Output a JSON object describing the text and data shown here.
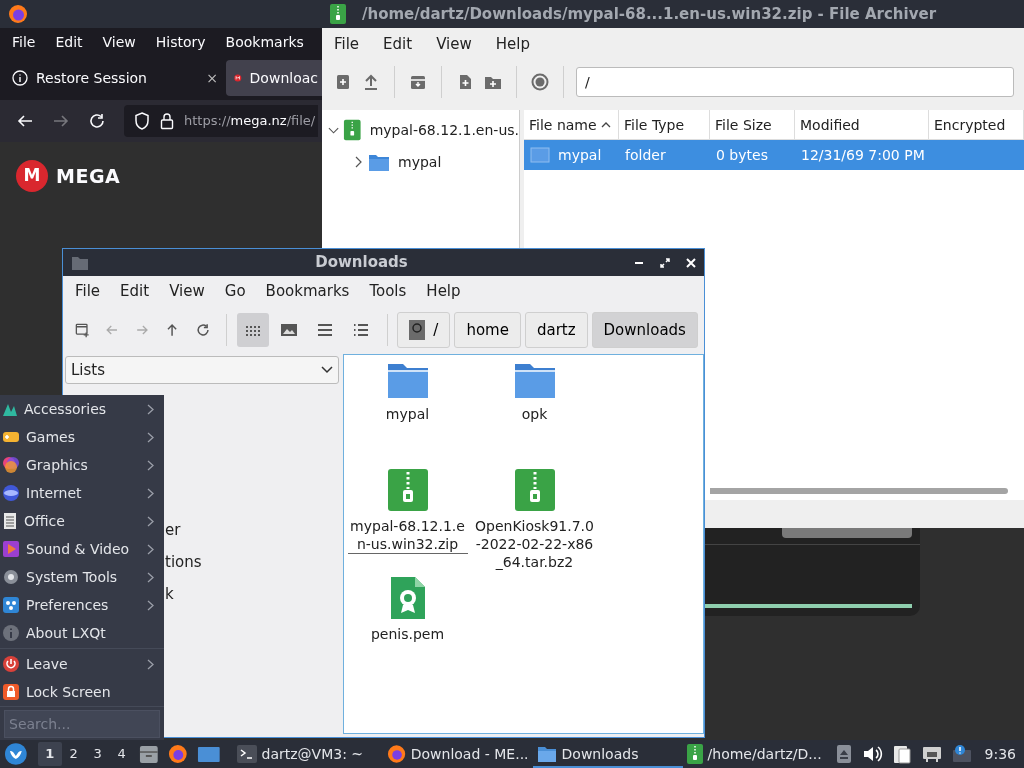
{
  "browser": {
    "menu": [
      "File",
      "Edit",
      "View",
      "History",
      "Bookmarks"
    ],
    "tabs": [
      {
        "label": "Restore Session",
        "selected": false,
        "close": "×"
      },
      {
        "label": "Downloac",
        "selected": true
      }
    ],
    "url_parts": [
      "https://",
      "mega.nz",
      "/file/"
    ],
    "logo_letter": "M",
    "brand": "MEGA"
  },
  "archiver": {
    "title": "/home/dartz/Downloads/mypal-68...1.en-us.win32.zip - File Archiver",
    "menu": [
      "File",
      "Edit",
      "View",
      "Help"
    ],
    "path": "/",
    "tree": [
      {
        "label": "mypal-68.12.1.en-us.",
        "expanded": true,
        "children": [
          {
            "label": "mypal",
            "expanded": false
          }
        ]
      }
    ],
    "columns": [
      {
        "label": "File name",
        "sorted": true
      },
      {
        "label": "File Type",
        "sorted": false
      },
      {
        "label": "File Size",
        "sorted": false
      },
      {
        "label": "Modified",
        "sorted": false
      },
      {
        "label": "Encrypted",
        "sorted": false
      }
    ],
    "rows": [
      {
        "cells": [
          "mypal",
          "folder",
          "0 bytes",
          "12/31/69 7:00 PM"
        ],
        "selected": true
      }
    ]
  },
  "downloads": {
    "title": "Downloads",
    "menu": [
      "File",
      "Edit",
      "View",
      "Go",
      "Bookmarks",
      "Tools",
      "Help"
    ],
    "view_modes": [
      {
        "kind": "icons",
        "selected": true
      },
      {
        "kind": "thumbnails",
        "selected": false
      },
      {
        "kind": "compact",
        "selected": false
      },
      {
        "kind": "details",
        "selected": false
      }
    ],
    "breadcrumbs": [
      {
        "label": "/",
        "kind": "root",
        "selected": false
      },
      {
        "label": "home",
        "kind": "dir",
        "selected": false
      },
      {
        "label": "dartz",
        "kind": "dir",
        "selected": false
      },
      {
        "label": "Downloads",
        "kind": "dir",
        "selected": true
      }
    ],
    "side_dropdown": "Lists",
    "side_items": [
      "er",
      "tions",
      "k"
    ],
    "files": [
      {
        "name": "mypal",
        "kind": "folder",
        "current": false
      },
      {
        "name": "opk",
        "kind": "folder",
        "current": false
      },
      {
        "name": "mypal-68.12.1.en-us.win32.zip",
        "kind": "archive",
        "current": true
      },
      {
        "name": "OpenKiosk91.7.0-2022-02-22-x86_64.tar.bz2",
        "kind": "archive",
        "current": false
      },
      {
        "name": "penis.pem",
        "kind": "certificate",
        "current": false
      }
    ]
  },
  "start_menu": {
    "items": [
      {
        "label": "Accessories",
        "kind": "submenu"
      },
      {
        "label": "Games",
        "kind": "submenu"
      },
      {
        "label": "Graphics",
        "kind": "submenu"
      },
      {
        "label": "Internet",
        "kind": "submenu"
      },
      {
        "label": "Office",
        "kind": "submenu"
      },
      {
        "label": "Sound & Video",
        "kind": "submenu"
      },
      {
        "label": "System Tools",
        "kind": "submenu"
      },
      {
        "label": "Preferences",
        "kind": "submenu"
      },
      {
        "label": "About LXQt",
        "kind": "action"
      },
      {
        "label": "Leave",
        "kind": "submenu",
        "separator": true
      },
      {
        "label": "Lock Screen",
        "kind": "action"
      }
    ],
    "search_placeholder": "Search..."
  },
  "taskbar": {
    "desktops": [
      {
        "label": "1",
        "selected": true
      },
      {
        "label": "2",
        "selected": false
      },
      {
        "label": "3",
        "selected": false
      },
      {
        "label": "4",
        "selected": false
      }
    ],
    "tasks": [
      {
        "label": "dartz@VM3: ~",
        "kind": "terminal",
        "selected": false
      },
      {
        "label": "Download - ME...",
        "kind": "browser",
        "selected": false
      },
      {
        "label": "Downloads",
        "kind": "files",
        "selected": true
      },
      {
        "label": "/home/dartz/D...",
        "kind": "archive",
        "selected": false
      }
    ],
    "clock": "9:36"
  }
}
